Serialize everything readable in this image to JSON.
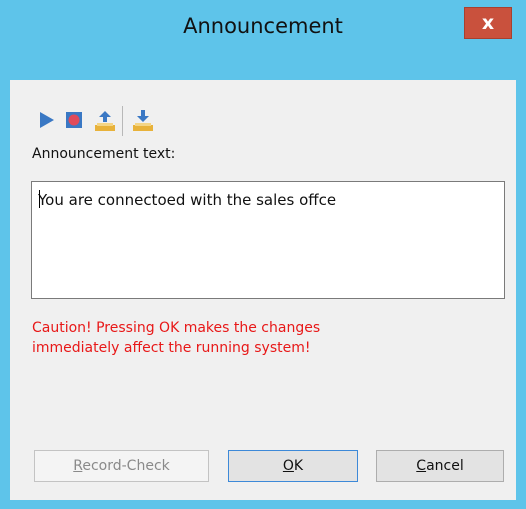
{
  "window": {
    "title": "Announcement",
    "close_label": "x"
  },
  "toolbar": {
    "buttons": [
      {
        "icon": "play-icon",
        "color": "#3a78c4"
      },
      {
        "icon": "record-icon",
        "color": "#e04a5a"
      },
      {
        "icon": "upload-icon",
        "color": "#e8b23a"
      },
      {
        "icon": "download-icon",
        "color": "#e8b23a"
      }
    ]
  },
  "form": {
    "label": "Announcement text:",
    "text_value": "You are connectoed with the sales offce",
    "caution_line1": "Caution! Pressing OK makes the changes",
    "caution_line2": "immediately affect the running system!",
    "caution_color": "#e81818"
  },
  "buttons": {
    "record_check": {
      "first": "R",
      "rest": "ecord-Check",
      "enabled": false
    },
    "ok": {
      "first": "O",
      "rest": "K",
      "enabled": true
    },
    "cancel": {
      "first": "C",
      "rest": "ancel",
      "enabled": true
    }
  },
  "colors": {
    "title_bar": "#5ec4ea",
    "close_button": "#c9513d",
    "accent_border": "#3d89d8"
  }
}
